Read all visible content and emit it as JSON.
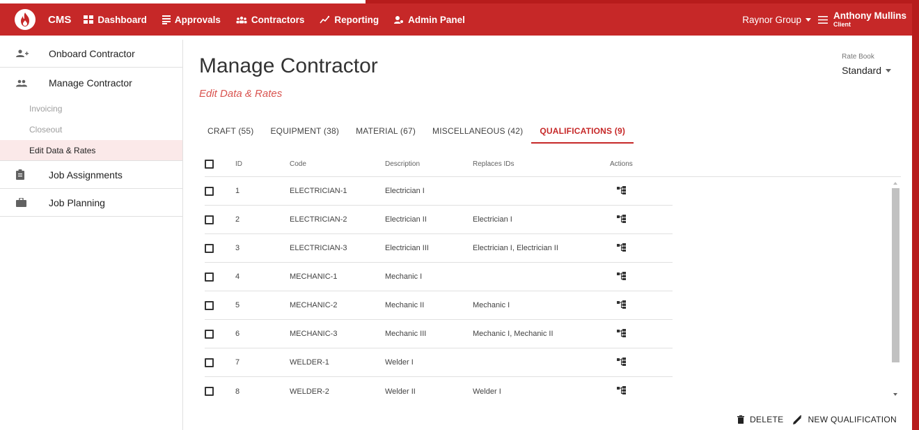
{
  "header": {
    "brand": "CMS",
    "nav": [
      {
        "label": "Dashboard",
        "icon": "dashboard-icon"
      },
      {
        "label": "Approvals",
        "icon": "approvals-icon"
      },
      {
        "label": "Contractors",
        "icon": "contractors-icon"
      },
      {
        "label": "Reporting",
        "icon": "reporting-icon"
      },
      {
        "label": "Admin Panel",
        "icon": "admin-panel-icon"
      }
    ],
    "company": "Raynor Group",
    "user_name": "Anthony Mullins",
    "user_role": "Client"
  },
  "sidebar": {
    "onboard": "Onboard Contractor",
    "manage": "Manage Contractor",
    "subitems": [
      "Invoicing",
      "Closeout",
      "Edit Data & Rates"
    ],
    "job_assignments": "Job Assignments",
    "job_planning": "Job Planning"
  },
  "main": {
    "title": "Manage Contractor",
    "subtitle": "Edit Data & Rates",
    "ratebook_label": "Rate Book",
    "ratebook_value": "Standard",
    "tabs": [
      "CRAFT (55)",
      "EQUIPMENT (38)",
      "MATERIAL (67)",
      "MISCELLANEOUS (42)",
      "QUALIFICATIONS (9)"
    ],
    "active_tab": "QUALIFICATIONS (9)",
    "columns": {
      "id": "ID",
      "code": "Code",
      "description": "Description",
      "replaces": "Replaces IDs",
      "actions": "Actions"
    },
    "rows": [
      {
        "id": "1",
        "code": "ELECTRICIAN-1",
        "description": "Electrician I",
        "replaces": ""
      },
      {
        "id": "2",
        "code": "ELECTRICIAN-2",
        "description": "Electrician II",
        "replaces": "Electrician I"
      },
      {
        "id": "3",
        "code": "ELECTRICIAN-3",
        "description": "Electrician III",
        "replaces": "Electrician I, Electrician II"
      },
      {
        "id": "4",
        "code": "MECHANIC-1",
        "description": "Mechanic I",
        "replaces": ""
      },
      {
        "id": "5",
        "code": "MECHANIC-2",
        "description": "Mechanic II",
        "replaces": "Mechanic I"
      },
      {
        "id": "6",
        "code": "MECHANIC-3",
        "description": "Mechanic III",
        "replaces": "Mechanic I, Mechanic II"
      },
      {
        "id": "7",
        "code": "WELDER-1",
        "description": "Welder I",
        "replaces": ""
      },
      {
        "id": "8",
        "code": "WELDER-2",
        "description": "Welder II",
        "replaces": "Welder I"
      }
    ],
    "delete_label": "DELETE",
    "new_label": "NEW QUALIFICATION"
  },
  "colors": {
    "brand_red": "#c62828",
    "accent_red": "#d9534f",
    "active_bg": "#fbe9e9"
  }
}
